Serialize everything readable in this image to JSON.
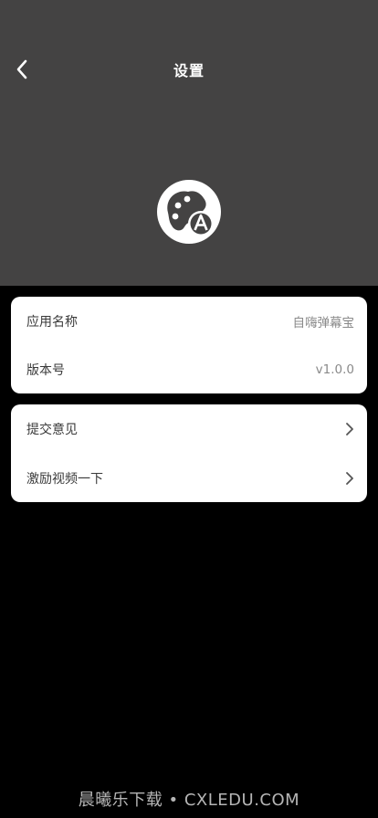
{
  "header": {
    "title": "设置",
    "bg_color": "#444343",
    "back_icon": "chevron-left-icon",
    "logo_icon": "palette-a-logo"
  },
  "app_info": {
    "rows": [
      {
        "label": "应用名称",
        "value": "自嗨弹幕宝"
      },
      {
        "label": "版本号",
        "value": "v1.0.0"
      }
    ]
  },
  "actions": {
    "rows": [
      {
        "label": "提交意见",
        "icon": "chevron-right-icon"
      },
      {
        "label": "激励视频一下",
        "icon": "chevron-right-icon"
      }
    ]
  },
  "watermark": "晨曦乐下载 • CXLEDU.COM"
}
